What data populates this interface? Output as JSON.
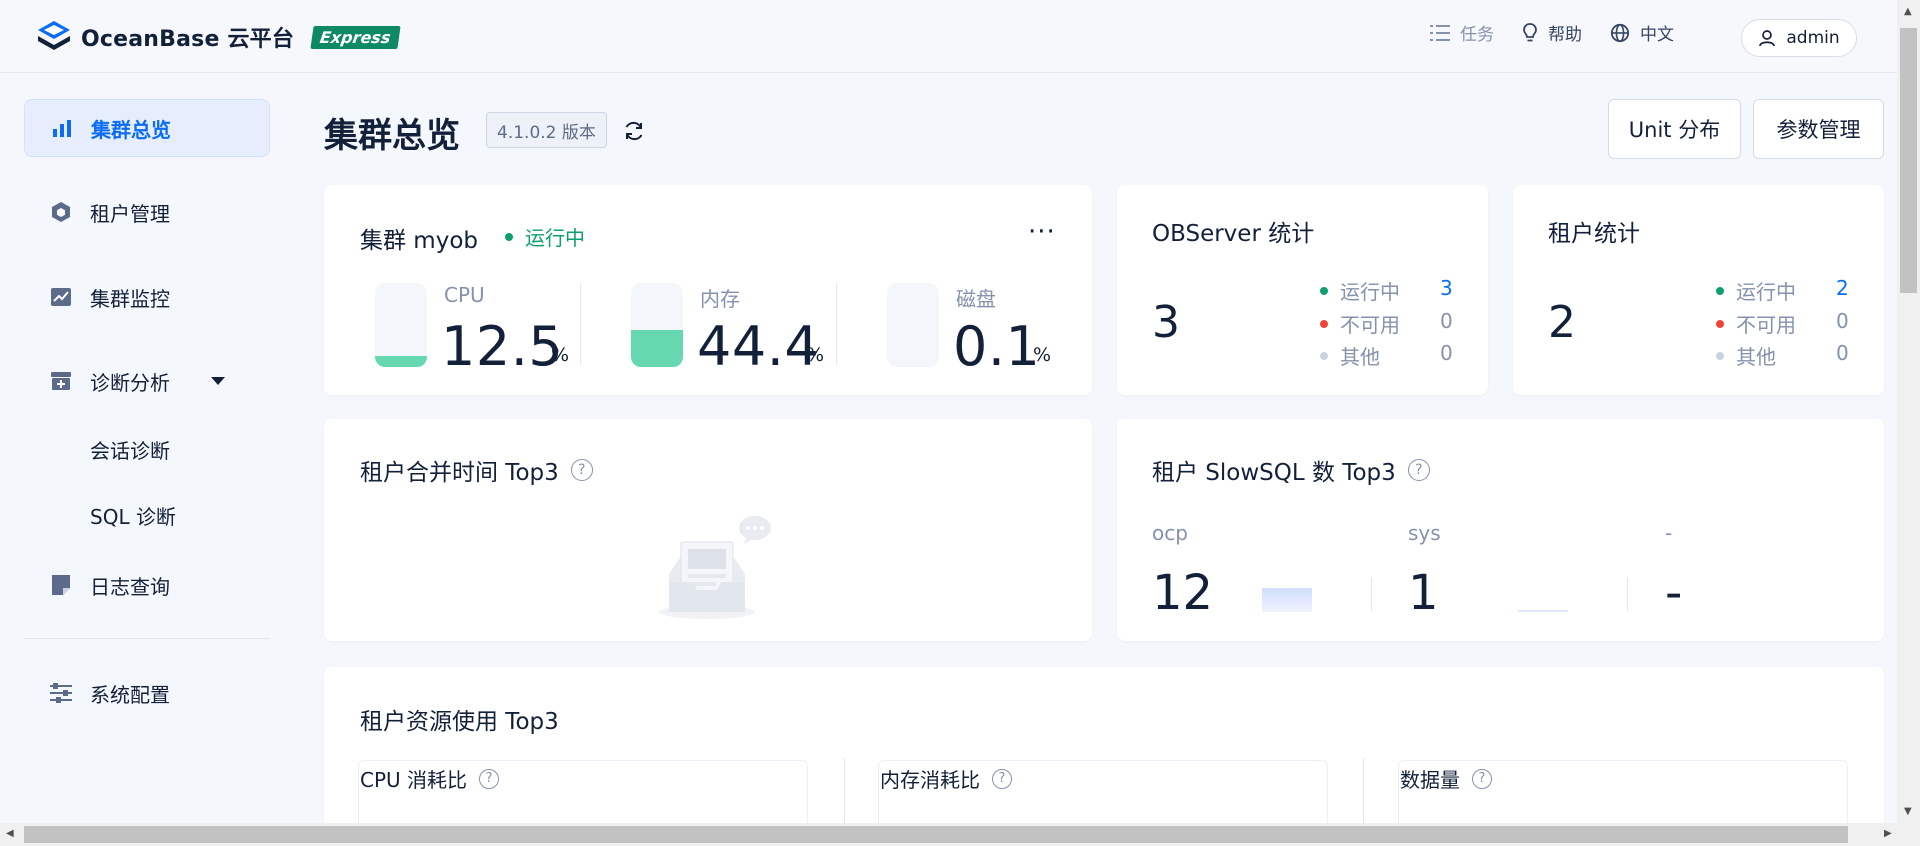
{
  "app": {
    "brand": "OceanBase 云平台",
    "badge": "Express"
  },
  "topbar": {
    "tasks_label": "任务",
    "help_label": "帮助",
    "lang_label": "中文",
    "user_label": "admin",
    "icons": [
      "list-icon",
      "bulb-icon",
      "globe-icon",
      "user-icon"
    ]
  },
  "sidebar": {
    "items": [
      {
        "label": "集群总览",
        "icon": "bar-chart-icon",
        "active": true
      },
      {
        "label": "租户管理",
        "icon": "hexagon-icon"
      },
      {
        "label": "集群监控",
        "icon": "line-chart-icon"
      },
      {
        "label": "诊断分析",
        "icon": "diagnosis-icon",
        "expanded": true,
        "children": [
          "会话诊断",
          "SQL 诊断"
        ]
      },
      {
        "label": "日志查询",
        "icon": "log-icon"
      },
      {
        "label": "系统配置",
        "icon": "sliders-icon"
      }
    ]
  },
  "header": {
    "title": "集群总览",
    "version": "4.1.0.2 版本",
    "unit_button": "Unit 分布",
    "params_button": "参数管理"
  },
  "cluster_card": {
    "title": "集群 myob",
    "status": "运行中",
    "status_color": "#0e9f6e",
    "metrics": [
      {
        "label": "CPU",
        "value": "12.5",
        "unit": "%",
        "fill": 0.125
      },
      {
        "label": "内存",
        "value": "44.4",
        "unit": "%",
        "fill": 0.444
      },
      {
        "label": "磁盘",
        "value": "0.1",
        "unit": "%",
        "fill": 0.001
      }
    ]
  },
  "observer_card": {
    "title": "OBServer 统计",
    "total": "3",
    "rows": [
      {
        "label": "运行中",
        "value": "3",
        "color": "#0e9f6e"
      },
      {
        "label": "不可用",
        "value": "0",
        "color": "#f04438"
      },
      {
        "label": "其他",
        "value": "0",
        "color": "#c9d2e3"
      }
    ]
  },
  "tenant_card": {
    "title": "租户统计",
    "total": "2",
    "rows": [
      {
        "label": "运行中",
        "value": "2",
        "color": "#0e9f6e"
      },
      {
        "label": "不可用",
        "value": "0",
        "color": "#f04438"
      },
      {
        "label": "其他",
        "value": "0",
        "color": "#c9d2e3"
      }
    ]
  },
  "merge_card": {
    "title": "租户合并时间 Top3"
  },
  "slowsql_card": {
    "title": "租户 SlowSQL 数 Top3",
    "items": [
      {
        "label": "ocp",
        "value": "12"
      },
      {
        "label": "sys",
        "value": "1"
      },
      {
        "label": "-",
        "value": "-"
      }
    ]
  },
  "resource_card": {
    "title": "租户资源使用 Top3",
    "columns": [
      "CPU 消耗比",
      "内存消耗比",
      "数据量"
    ]
  },
  "accent_color": "#0b6cf5"
}
